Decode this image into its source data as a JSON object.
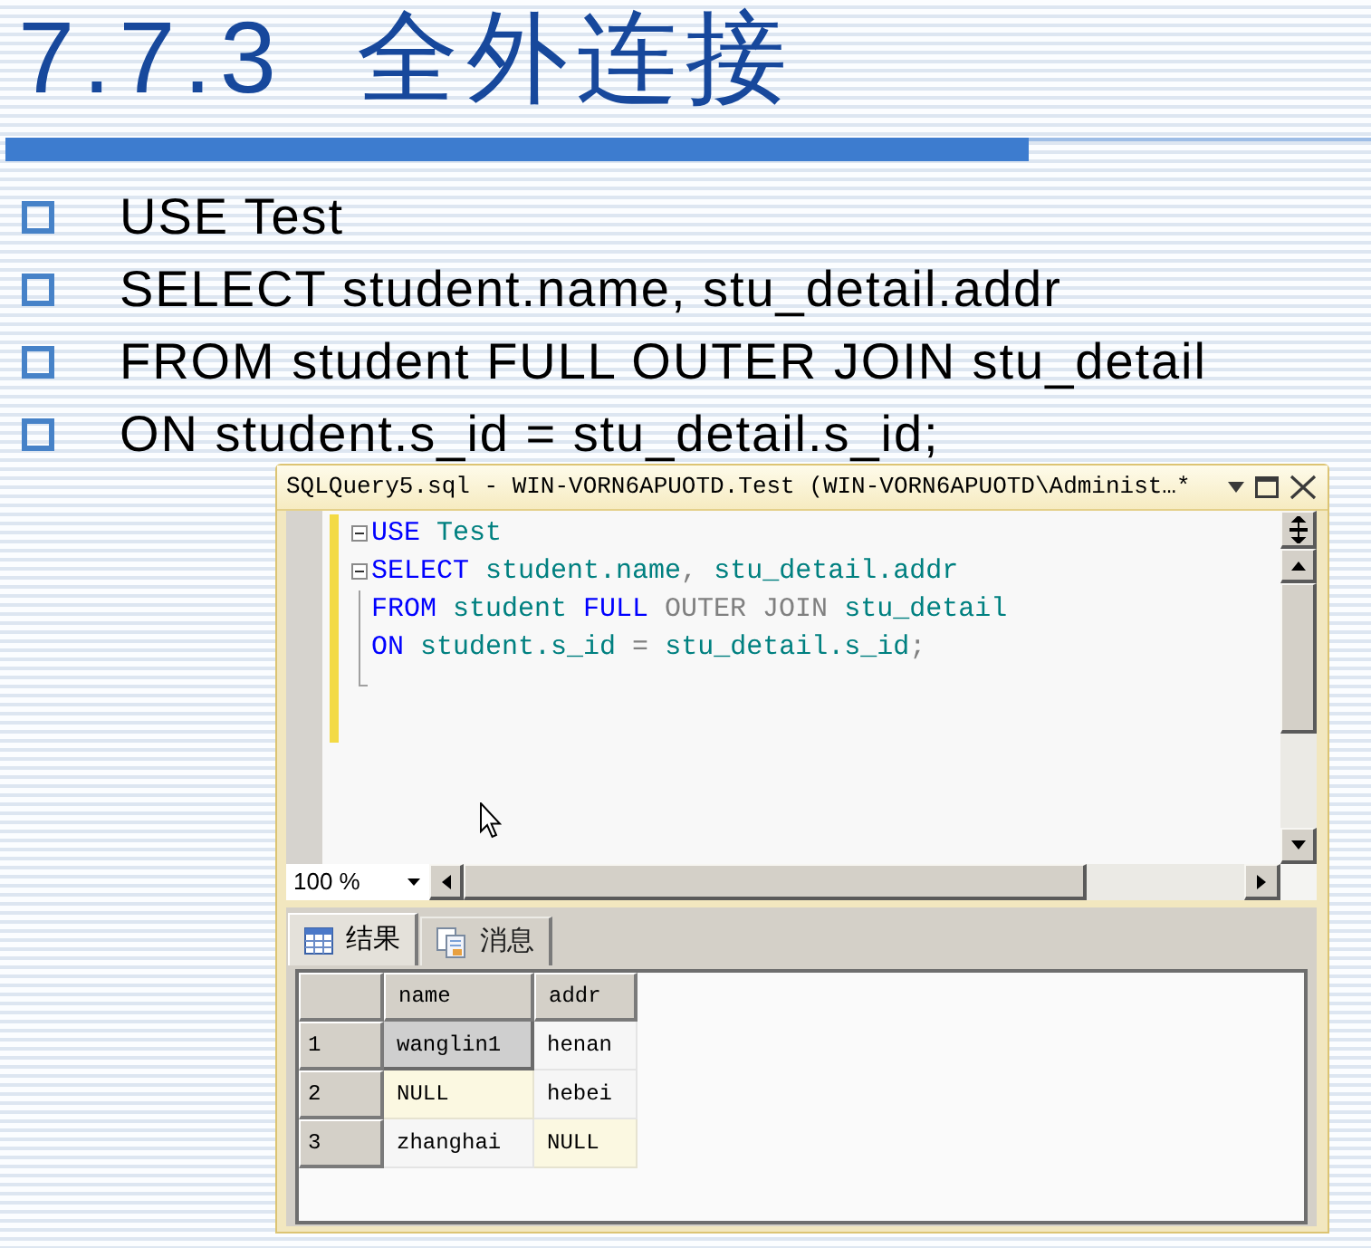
{
  "slide": {
    "title": "7.7.3  全外连接",
    "bullets": [
      "USE Test",
      "SELECT student.name, stu_detail.addr",
      "FROM student FULL OUTER JOIN stu_detail",
      "ON student.s_id = stu_detail.s_id;"
    ]
  },
  "query_window": {
    "title": "SQLQuery5.sql - WIN-VORN6APUOTD.Test (WIN-VORN6APUOTD\\Administ…*",
    "editor": {
      "lines": [
        {
          "kind": "opener",
          "modified": true,
          "tokens": [
            {
              "text": "USE",
              "kind": "keyword"
            },
            {
              "text": " Test",
              "kind": "identifier"
            }
          ]
        },
        {
          "kind": "opener",
          "modified": true,
          "tokens": [
            {
              "text": "SELECT",
              "kind": "keyword"
            },
            {
              "text": " student.name",
              "kind": "identifier"
            },
            {
              "text": ",",
              "kind": "operator"
            },
            {
              "text": " stu_detail.addr",
              "kind": "identifier"
            }
          ]
        },
        {
          "kind": "inner",
          "modified": true,
          "tokens": [
            {
              "text": "FROM",
              "kind": "keyword"
            },
            {
              "text": " student",
              "kind": "identifier"
            },
            {
              "text": " FULL",
              "kind": "keyword"
            },
            {
              "text": " OUTER JOIN",
              "kind": "operator"
            },
            {
              "text": " stu_detail",
              "kind": "identifier"
            }
          ]
        },
        {
          "kind": "inner",
          "modified": true,
          "tokens": [
            {
              "text": "ON",
              "kind": "keyword"
            },
            {
              "text": " student.s_id",
              "kind": "identifier"
            },
            {
              "text": " =",
              "kind": "operator"
            },
            {
              "text": " stu_detail.s_id",
              "kind": "identifier"
            },
            {
              "text": ";",
              "kind": "operator"
            }
          ]
        },
        {
          "kind": "closer",
          "modified": true
        },
        {
          "kind": "plain",
          "modified": true
        }
      ]
    },
    "zoom": "100 %",
    "result_tabs": [
      {
        "label": "结果",
        "kind": "grid",
        "selected": true
      },
      {
        "label": "消息",
        "kind": "messages",
        "selected": false
      }
    ],
    "results": {
      "columns": [
        "name",
        "addr"
      ],
      "rows": [
        {
          "number": "1",
          "cells": [
            {
              "text": "wanglin1",
              "selected": true,
              "is_null": false
            },
            {
              "text": "henan",
              "selected": false,
              "is_null": false
            }
          ]
        },
        {
          "number": "2",
          "cells": [
            {
              "text": "NULL",
              "selected": false,
              "is_null": true
            },
            {
              "text": "hebei",
              "selected": false,
              "is_null": false
            }
          ]
        },
        {
          "number": "3",
          "cells": [
            {
              "text": "zhanghai",
              "selected": false,
              "is_null": false
            },
            {
              "text": "NULL",
              "selected": false,
              "is_null": true
            }
          ]
        }
      ]
    }
  }
}
